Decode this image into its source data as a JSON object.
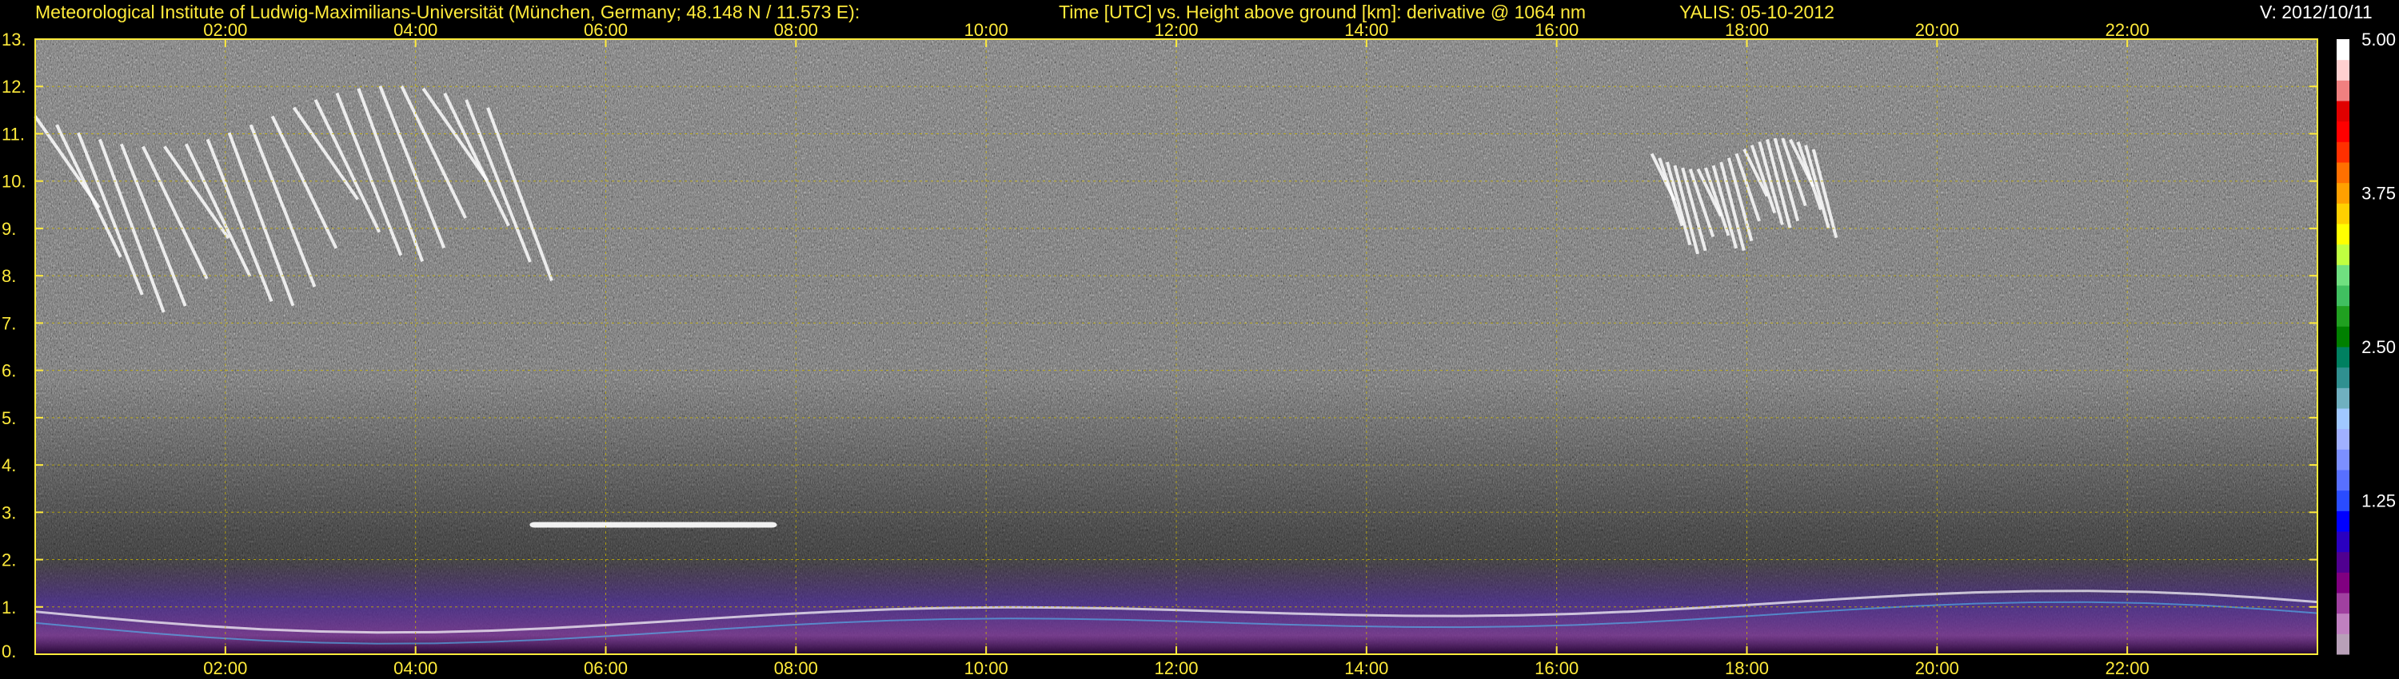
{
  "header": {
    "institute": "Meteorological Institute of Ludwig-Maximilians-Universität (München, Germany; 48.148 N / 11.573 E):",
    "description": "Time [UTC] vs. Height above ground [km]: derivative @ 1064 nm",
    "instrument_date": "YALIS: 05-10-2012",
    "version": "V: 2012/10/11"
  },
  "chart_data": {
    "type": "heatmap",
    "title": "Time [UTC] vs. Height above ground [km]: derivative @ 1064 nm",
    "x_tick_labels": [
      "02:00",
      "04:00",
      "06:00",
      "08:00",
      "10:00",
      "12:00",
      "14:00",
      "16:00",
      "18:00",
      "20:00",
      "22:00"
    ],
    "x_ticks_hours": [
      2,
      4,
      6,
      8,
      10,
      12,
      14,
      16,
      18,
      20,
      22
    ],
    "xlim_hours": [
      0,
      24
    ],
    "y_tick_labels": [
      "0.",
      "1.",
      "2.",
      "3.",
      "4.",
      "5.",
      "6.",
      "7.",
      "8.",
      "9.",
      "10.",
      "11.",
      "12.",
      "13."
    ],
    "y_ticks_km": [
      0,
      1,
      2,
      3,
      4,
      5,
      6,
      7,
      8,
      9,
      10,
      11,
      12,
      13
    ],
    "ylim_km": [
      0,
      13
    ],
    "grid": true,
    "colorbar": {
      "ticks": [
        1.25,
        2.5,
        3.75,
        5.0
      ],
      "tick_labels": [
        "1.25",
        "2.50",
        "3.75",
        "5.00"
      ],
      "range": [
        0,
        5
      ],
      "colors": [
        "#b8a0b8",
        "#c080c0",
        "#a040a0",
        "#800080",
        "#500090",
        "#2a00c0",
        "#0000ff",
        "#2a4cff",
        "#5870ff",
        "#7c90ff",
        "#a0b0ff",
        "#a0c8ff",
        "#70b0c0",
        "#309090",
        "#008060",
        "#008000",
        "#20a020",
        "#40c060",
        "#70e080",
        "#c0ff40",
        "#ffff00",
        "#ffd000",
        "#ffa000",
        "#ff7000",
        "#ff3000",
        "#ff0000",
        "#e00000",
        "#f08080",
        "#ffd0d0",
        "#ffffff"
      ]
    },
    "features": [
      {
        "name": "cirrus",
        "x_hours": [
          0.0,
          5.6
        ],
        "y_km": [
          7.5,
          11.8
        ]
      },
      {
        "name": "cirrus",
        "x_hours": [
          17.0,
          19.0
        ],
        "y_km": [
          8.6,
          10.8
        ]
      },
      {
        "name": "aerosol layer",
        "x_hours": [
          5.2,
          7.8
        ],
        "y_km": [
          2.6,
          2.9
        ]
      },
      {
        "name": "boundary layer",
        "x_hours": [
          0.0,
          24.0
        ],
        "y_km": [
          0.0,
          2.0
        ]
      }
    ]
  }
}
